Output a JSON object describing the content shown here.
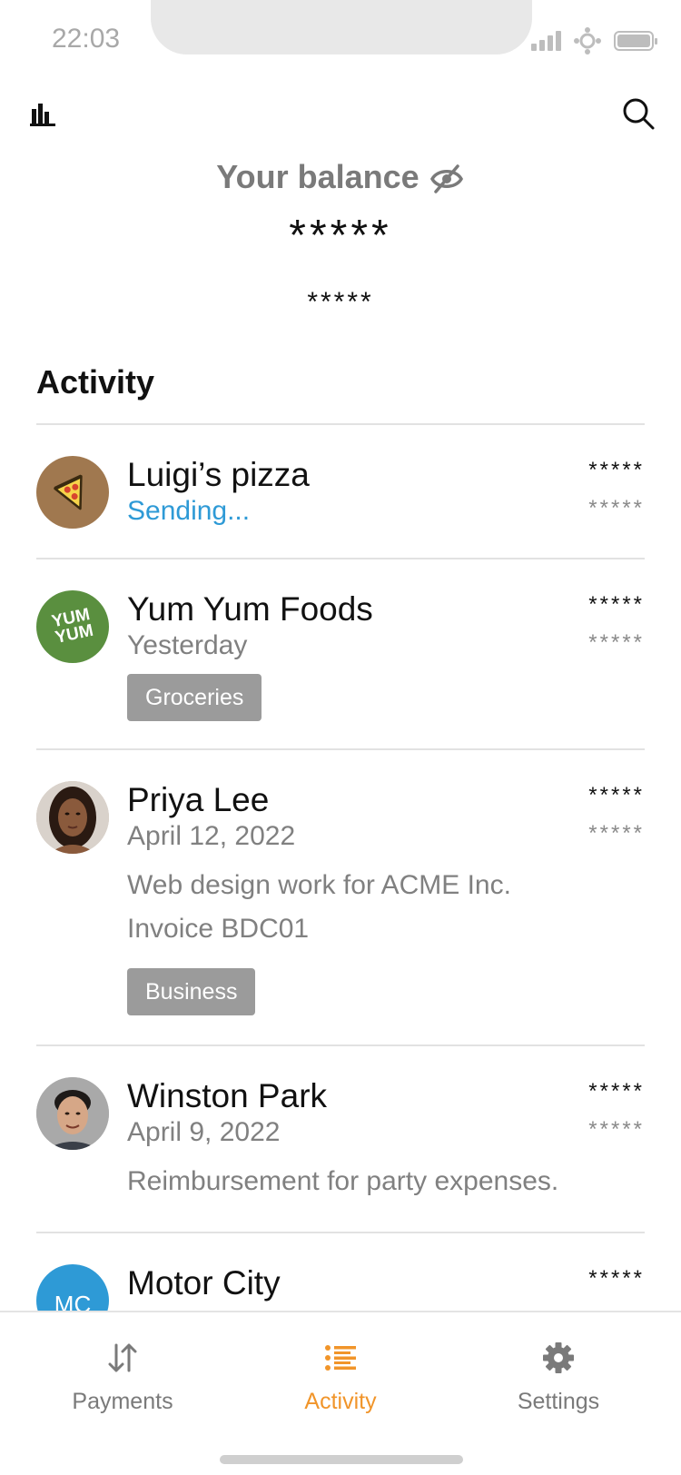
{
  "status_bar": {
    "time": "22:03"
  },
  "balance": {
    "heading": "Your balance",
    "amount": "*****",
    "secondary": "*****"
  },
  "activity": {
    "title": "Activity",
    "items": [
      {
        "name": "Luigi’s pizza",
        "status": "Sending...",
        "amount": "*****",
        "amount_secondary": "*****",
        "avatar": "pizza-logo"
      },
      {
        "name": "Yum Yum Foods",
        "date": "Yesterday",
        "amount": "*****",
        "amount_secondary": "*****",
        "tag": "Groceries",
        "avatar_text": "YUM YUM"
      },
      {
        "name": "Priya Lee",
        "date": "April 12, 2022",
        "amount": "*****",
        "amount_secondary": "*****",
        "note_line1": "Web design work for ACME Inc.",
        "note_line2": "Invoice BDC01",
        "tag": "Business",
        "avatar": "person-photo"
      },
      {
        "name": "Winston Park",
        "date": "April 9, 2022",
        "amount": "*****",
        "amount_secondary": "*****",
        "note_line1": "Reimbursement for party expenses.",
        "avatar": "person-photo"
      },
      {
        "name": "Motor City",
        "amount": "*****",
        "avatar_text": "MC"
      }
    ]
  },
  "tabs": [
    {
      "label": "Payments",
      "icon": "transfer-arrows-icon",
      "active": false
    },
    {
      "label": "Activity",
      "icon": "list-icon",
      "active": true
    },
    {
      "label": "Settings",
      "icon": "gear-icon",
      "active": false
    }
  ],
  "colors": {
    "accent": "#f1952a",
    "sending": "#2e9ad6",
    "tag_bg": "#9b9b9b",
    "muted_text": "#808080"
  }
}
